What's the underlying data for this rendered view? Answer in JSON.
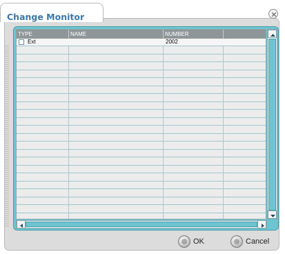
{
  "dialog": {
    "title": "Change Monitor"
  },
  "table": {
    "columns": [
      "TYPE",
      "NAME",
      "NUMBER",
      ""
    ],
    "rows": [
      {
        "type": "Ext",
        "name": "",
        "number": "2002"
      }
    ]
  },
  "buttons": {
    "ok": "OK",
    "cancel": "Cancel"
  },
  "colors": {
    "accent": "#6ec5d2",
    "title": "#3c77a6",
    "header": "#8f9698"
  },
  "icons": [
    "close-icon",
    "checkbox-icon",
    "scroll-up-icon",
    "scroll-down-icon",
    "scroll-left-icon",
    "scroll-right-icon",
    "ok-icon",
    "cancel-icon"
  ]
}
